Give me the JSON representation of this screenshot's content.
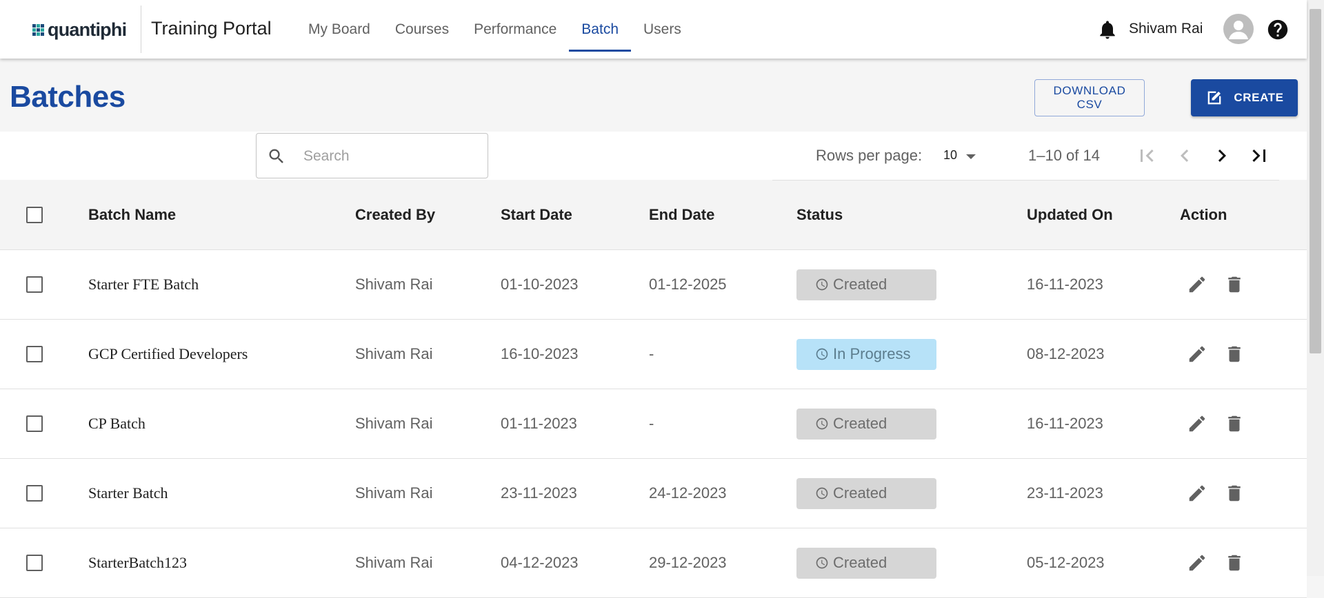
{
  "header": {
    "logo_text": "quantiphi",
    "app_title": "Training Portal",
    "nav": [
      {
        "label": "My Board",
        "active": false
      },
      {
        "label": "Courses",
        "active": false
      },
      {
        "label": "Performance",
        "active": false
      },
      {
        "label": "Batch",
        "active": true
      },
      {
        "label": "Users",
        "active": false
      }
    ],
    "user_name": "Shivam Rai",
    "icons": [
      "notifications-icon",
      "account-icon",
      "help-icon"
    ]
  },
  "page": {
    "title": "Batches",
    "download_label": "DOWNLOAD CSV",
    "create_label": "CREATE"
  },
  "toolbar": {
    "search_placeholder": "Search",
    "search_value": "",
    "rows_per_page_label": "Rows per page:",
    "rows_per_page": "10",
    "range": "1–10 of 14"
  },
  "table": {
    "columns": [
      "Batch Name",
      "Created By",
      "Start Date",
      "End Date",
      "Status",
      "Updated On",
      "Action"
    ],
    "rows": [
      {
        "name": "Starter FTE Batch",
        "created_by": "Shivam Rai",
        "start": "01-10-2023",
        "end": "01-12-2025",
        "status": "Created",
        "updated": "16-11-2023"
      },
      {
        "name": "GCP Certified Developers",
        "created_by": "Shivam Rai",
        "start": "16-10-2023",
        "end": "-",
        "status": "In Progress",
        "updated": "08-12-2023"
      },
      {
        "name": "CP Batch",
        "created_by": "Shivam Rai",
        "start": "01-11-2023",
        "end": "-",
        "status": "Created",
        "updated": "16-11-2023"
      },
      {
        "name": "Starter Batch",
        "created_by": "Shivam Rai",
        "start": "23-11-2023",
        "end": "24-12-2023",
        "status": "Created",
        "updated": "23-11-2023"
      },
      {
        "name": "StarterBatch123",
        "created_by": "Shivam Rai",
        "start": "04-12-2023",
        "end": "29-12-2023",
        "status": "Created",
        "updated": "05-12-2023"
      }
    ]
  },
  "colors": {
    "primary": "#1a4aa0",
    "status_created_bg": "#d6d6d6",
    "status_in_progress_bg": "#b7e2f8"
  }
}
